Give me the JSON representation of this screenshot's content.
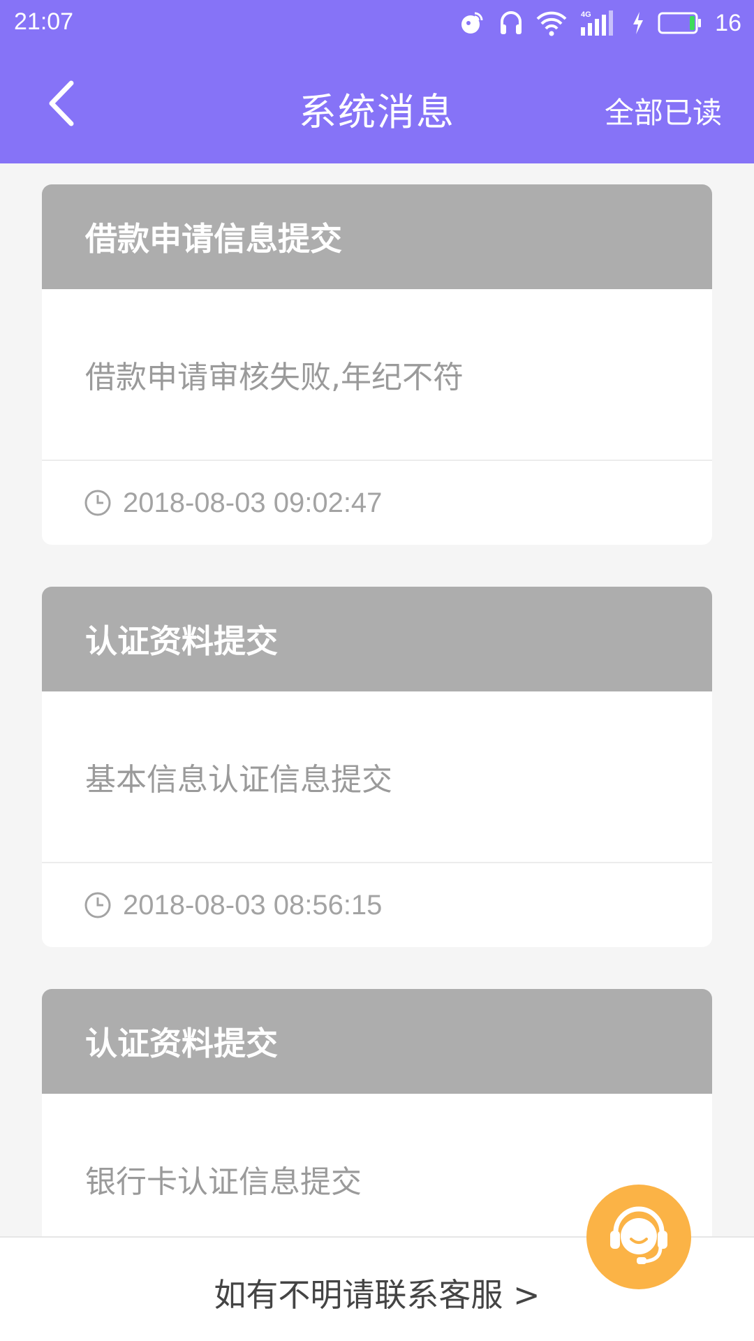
{
  "status_bar": {
    "time": "21:07",
    "battery_percent": "16",
    "icons": [
      "nfc-icon",
      "headphone-icon",
      "wifi-icon",
      "signal-4g-icon",
      "charging-icon",
      "battery-icon"
    ]
  },
  "header": {
    "title": "系统消息",
    "mark_all_read": "全部已读",
    "back_icon": "chevron-left-icon"
  },
  "messages": [
    {
      "title": "借款申请信息提交",
      "content": "借款申请审核失败,年纪不符",
      "time": "2018-08-03 09:02:47"
    },
    {
      "title": "认证资料提交",
      "content": "基本信息认证信息提交",
      "time": "2018-08-03 08:56:15"
    },
    {
      "title": "认证资料提交",
      "content": "银行卡认证信息提交",
      "time": ""
    }
  ],
  "footer": {
    "contact_text": "如有不明请联系客服 >"
  },
  "colors": {
    "primary": "#8673f7",
    "card_header": "#adadad",
    "customer_service": "#fbb346",
    "background": "#f5f5f5"
  }
}
